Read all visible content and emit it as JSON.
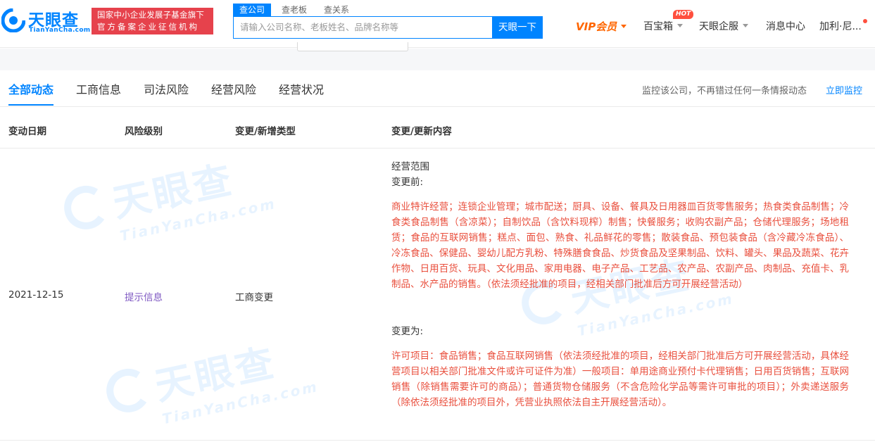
{
  "header": {
    "logo_cn": "天眼查",
    "logo_en": "TianYanCha.com",
    "badge_line1": "国家中小企业发展子基金旗下",
    "badge_line2": "官方备案企业征信机构",
    "search_tabs": [
      "查公司",
      "查老板",
      "查关系"
    ],
    "search_placeholder": "请输入公司名称、老板姓名、品牌名称等",
    "search_button": "天眼一下",
    "nav": {
      "vip": "VIP会员",
      "baibaoxiang": "百宝箱",
      "hot": "HOT",
      "qifu": "天眼企服",
      "messages": "消息中心",
      "user": "加利·尼..."
    }
  },
  "tabs": {
    "items": [
      "全部动态",
      "工商信息",
      "司法风险",
      "经营风险",
      "经营状况"
    ],
    "active_index": 0,
    "monitor_text": "监控该公司，不再错过任何一条情报动态",
    "monitor_link": "立即监控"
  },
  "table": {
    "headers": [
      "变动日期",
      "风险级别",
      "变更/新增类型",
      "变更/更新内容"
    ],
    "row": {
      "date": "2021-12-15",
      "risk": "提示信息",
      "type": "工商变更",
      "field": "经营范围",
      "before_label": "变更前:",
      "before_text": "商业特许经营；连锁企业管理；城市配送；厨具、设备、餐具及日用器皿百货零售服务；热食类食品制售；冷食类食品制售（含凉菜）；自制饮品（含饮料现榨）制售；快餐服务；收购农副产品；仓储代理服务；场地租赁；食品的互联网销售；糕点、面包、熟食、礼品鲜花的零售；散装食品、预包装食品（含冷藏冷冻食品）、冷冻食品、保健品、婴幼儿配方乳粉、特殊膳食食品、炒货食品及坚果制品、饮料、罐头、果品及蔬菜、花卉作物、日用百货、玩具、文化用品、家用电器、电子产品、工艺品、农产品、农副产品、肉制品、充值卡、乳制品、水产品的销售。（依法须经批准的项目，经相关部门批准后方可开展经营活动）",
      "after_label": "变更为:",
      "after_text": "许可项目：食品销售；食品互联网销售（依法须经批准的项目，经相关部门批准后方可开展经营活动，具体经营项目以相关部门批准文件或许可证件为准）一般项目：单用途商业预付卡代理销售；日用百货销售；互联网销售（除销售需要许可的商品）；普通货物仓储服务（不含危险化学品等需许可审批的项目）；外卖递送服务（除依法须经批准的项目外，凭营业执照依法自主开展经营活动）。"
    }
  },
  "colors": {
    "brand_blue": "#0084ff",
    "badge_red": "#e6424c",
    "vip_orange": "#ff6600",
    "highlight_red": "#e94f3d",
    "risk_purple": "#7e57c2"
  }
}
